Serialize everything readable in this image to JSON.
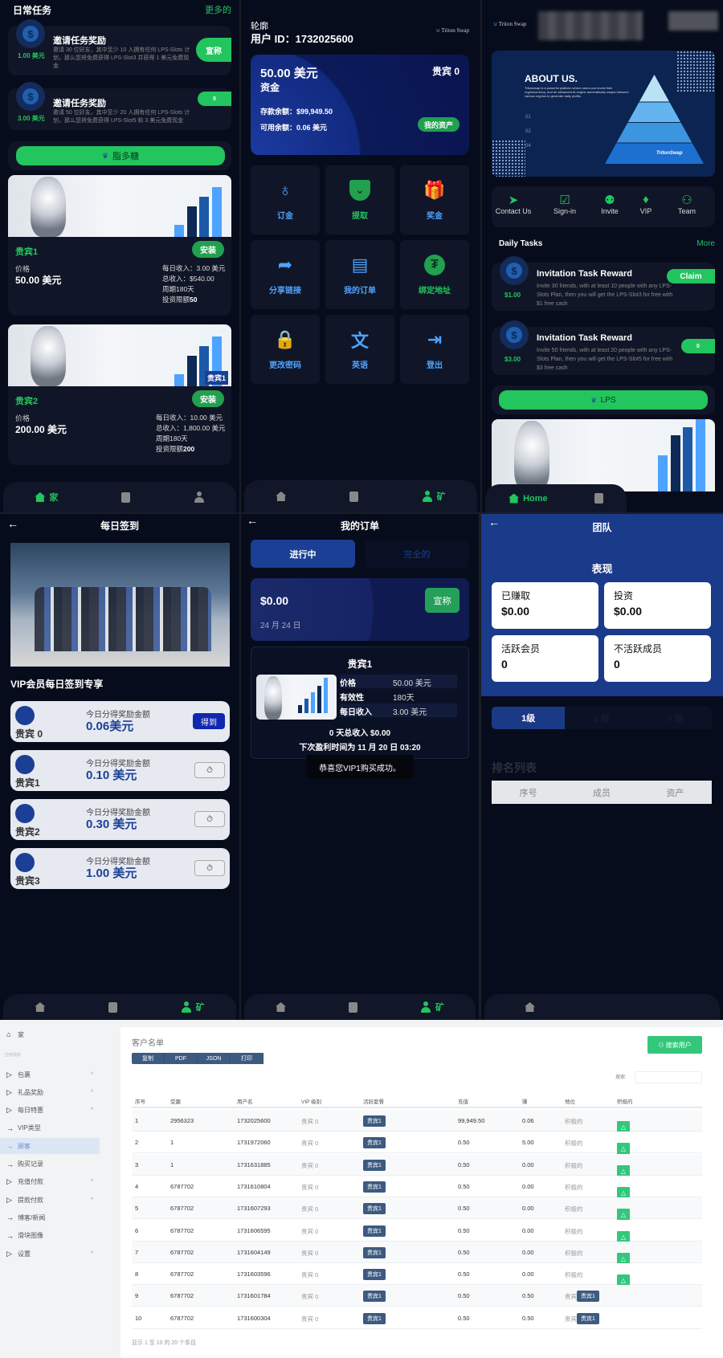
{
  "colors": {
    "bg": "#070c1c",
    "card": "#101627",
    "green": "#22c55e",
    "blue": "#4da3ff",
    "team_header": "#1a3a8a",
    "admin_badge": "#3d5a80"
  },
  "p1": {
    "title": "日常任务",
    "more": "更多的",
    "tasks": [
      {
        "amount": "1.00 美元",
        "title": "邀请任务奖励",
        "desc": "邀请 30 位好友，其中至少 10 人拥有任何 LPS-Slots 计划，那么您将免费获得 LPS-Slot3 并获得 1 美元免费现金",
        "button": "宣称"
      },
      {
        "amount": "3.00 美元",
        "title": "邀请任务奖励",
        "desc": "邀请 50 位好友，其中至少 20 人拥有任何 LPS-Slots 计划，那么您将免费获得 LPS-Slot5 和 3 美元免费现金",
        "button": "0"
      }
    ],
    "lps_button": "脂多糖",
    "products": [
      {
        "name": "贵宾1",
        "install": "安装",
        "price_label": "价格",
        "price": "50.00 美元",
        "lines": [
          "每日收入：3.00 美元",
          "总收入：$540.00",
          "周期180天"
        ],
        "limit_label": "投资限额",
        "limit": "50",
        "image_tag": ""
      },
      {
        "name": "贵宾2",
        "install": "安装",
        "price_label": "价格",
        "price": "200.00 美元",
        "lines": [
          "每日收入：10.00 美元",
          "总收入：1,800.00 美元",
          "周期180天"
        ],
        "limit_label": "投资限额",
        "limit": "200",
        "image_tag": "贵宾1"
      }
    ],
    "nav": {
      "home": "家"
    }
  },
  "p2": {
    "label": "轮廓",
    "user_id": "用户 ID：1732025600",
    "logo": "Triton Swap",
    "balance": "50.00 美元",
    "balance_label": "资金",
    "vip": "贵宾 0",
    "deposit": "存款余额：$99,949.50",
    "available": "可用余额：0.06 美元",
    "assets_button": "我的资产",
    "tiles": [
      {
        "label": "订金",
        "icon": "money-bag"
      },
      {
        "label": "提取",
        "icon": "withdraw"
      },
      {
        "label": "奖金",
        "icon": "gift"
      },
      {
        "label": "分享链接",
        "icon": "share"
      },
      {
        "label": "我的订单",
        "icon": "document"
      },
      {
        "label": "绑定地址",
        "icon": "tether"
      },
      {
        "label": "更改密码",
        "icon": "lock"
      },
      {
        "label": "英语",
        "icon": "translate"
      },
      {
        "label": "登出",
        "icon": "logout"
      }
    ],
    "nav": {
      "profile": "矿"
    }
  },
  "p3": {
    "logo": "Triton Swap",
    "about": {
      "title": "ABOUT US.",
      "text": "Tritonswap is a powerful platform where users can invest their cryptocurrency, and an advanced AI engine automatically swaps between various cryptos to generate daily profits.",
      "steps": [
        "01",
        "02",
        "04"
      ],
      "brand": "TritonSwap"
    },
    "quick": [
      "Contact Us",
      "Sign-in",
      "Invite",
      "VIP",
      "Team"
    ],
    "daily_title": "Daily Tasks",
    "more": "More",
    "tasks": [
      {
        "amount": "$1.00",
        "title": "Invitation Task Reward",
        "desc": "Invite 30 friends, with at least 10 people with any LPS-Slots Plan, then you will get the LPS-Slot3 for free with $1 free cash",
        "button": "Claim"
      },
      {
        "amount": "$3.00",
        "title": "Invitation Task Reward",
        "desc": "Invite 50 friends, with at least 20 people with any LPS-Slots Plan, then you will get the LPS-Slot5 for free with $3 free cash",
        "button": "0"
      }
    ],
    "lps_button": "LPS",
    "nav": {
      "home": "Home"
    }
  },
  "p4": {
    "title": "每日签到",
    "section": "VIP会员每日签到专享",
    "cards": [
      {
        "name": "贵宾 0",
        "label": "今日分得奖励金额",
        "amount": "0.06美元",
        "button": "得到"
      },
      {
        "name": "贵宾1",
        "label": "今日分得奖励金额",
        "amount": "0.10 美元",
        "button": "⏱"
      },
      {
        "name": "贵宾2",
        "label": "今日分得奖励金额",
        "amount": "0.30 美元",
        "button": "⏱"
      },
      {
        "name": "贵宾3",
        "label": "今日分得奖励金额",
        "amount": "1.00 美元",
        "button": "⏱"
      }
    ],
    "nav": {
      "profile": "矿"
    }
  },
  "p5": {
    "title": "我的订单",
    "tabs": [
      "进行中",
      "完全的"
    ],
    "amount": "$0.00",
    "date": "24 月 24 日",
    "claim": "宣称",
    "order": {
      "name": "贵宾1",
      "rows": [
        [
          "价格",
          "50.00 美元"
        ],
        [
          "有效性",
          "180天"
        ],
        [
          "每日收入",
          "3.00 美元"
        ]
      ],
      "total": "0 天总收入 $0.00",
      "next": "下次盈利时间为 11 月 20 日 03:20"
    },
    "toast": "恭喜您VIP1购买成功。",
    "nav": {
      "profile": "矿"
    }
  },
  "p6": {
    "title": "团队",
    "section": "表现",
    "stats": [
      {
        "label": "已赚取",
        "value": "$0.00"
      },
      {
        "label": "投资",
        "value": "$0.00"
      },
      {
        "label": "活跃会员",
        "value": "0"
      },
      {
        "label": "不活跃成员",
        "value": "0"
      }
    ],
    "levels": [
      "1级",
      "2 级",
      "3 级"
    ],
    "ranking": "排名列表",
    "columns": [
      "序号",
      "成员",
      "资产"
    ]
  },
  "admin": {
    "sidebar": {
      "home": "家",
      "group": "应用程序",
      "items": [
        {
          "label": "包裹",
          "type": "group"
        },
        {
          "label": "礼品奖励",
          "type": "group"
        },
        {
          "label": "每日特惠",
          "type": "group"
        },
        {
          "label": "VIP类型",
          "type": "link"
        },
        {
          "label": "顾客",
          "type": "link",
          "active": true
        },
        {
          "label": "购买记录",
          "type": "link"
        },
        {
          "label": "充值付款",
          "type": "group"
        },
        {
          "label": "提款付款",
          "type": "group"
        },
        {
          "label": "博客/新闻",
          "type": "link"
        },
        {
          "label": "滑块图像",
          "type": "link"
        },
        {
          "label": "设置",
          "type": "group"
        }
      ]
    },
    "title": "客户名单",
    "exports": [
      "复制",
      "PDF",
      "JSON",
      "打印"
    ],
    "search_user": "搜索用户",
    "search_label": "搜索:",
    "search_value": "",
    "columns": [
      "序号",
      "受趣",
      "用户名",
      "VIP 级别",
      "活跃套餐",
      "充值",
      "赚",
      "地位",
      "积极的"
    ],
    "rows": [
      [
        "1",
        "2956323",
        "1732025600",
        "贵宾 0",
        "贵宾1",
        "99,949.50",
        "0.06",
        "积极的",
        "actions"
      ],
      [
        "2",
        "1",
        "1731972060",
        "贵宾 0",
        "贵宾1",
        "0.50",
        "5.00",
        "积极的",
        "actions"
      ],
      [
        "3",
        "1",
        "1731631885",
        "贵宾 0",
        "贵宾1",
        "0.50",
        "0.00",
        "积极的",
        "actions"
      ],
      [
        "4",
        "6787702",
        "1731610804",
        "贵宾 0",
        "贵宾1",
        "0.50",
        "0.00",
        "积极的",
        "actions"
      ],
      [
        "5",
        "6787702",
        "1731607293",
        "贵宾 0",
        "贵宾1",
        "0.50",
        "0.00",
        "积极的",
        "actions"
      ],
      [
        "6",
        "6787702",
        "1731606595",
        "贵宾 0",
        "贵宾1",
        "0.50",
        "0.00",
        "积极的",
        "actions"
      ],
      [
        "7",
        "6787702",
        "1731604149",
        "贵宾 0",
        "贵宾1",
        "0.50",
        "0.00",
        "积极的",
        "actions"
      ],
      [
        "8",
        "6787702",
        "1731603596",
        "贵宾 0",
        "贵宾1",
        "0.50",
        "0.00",
        "积极的",
        "actions"
      ],
      [
        "9",
        "6787702",
        "1731601784",
        "贵宾 0",
        "贵宾1",
        "0.50",
        "0.50",
        "贵宾 0",
        "贵宾1"
      ],
      [
        "10",
        "6787702",
        "1731600304",
        "贵宾 0",
        "贵宾1",
        "0.50",
        "0.50",
        "贵宾 0",
        "贵宾1"
      ]
    ],
    "footer": "显示 1 至 10 的 20 个条目"
  }
}
